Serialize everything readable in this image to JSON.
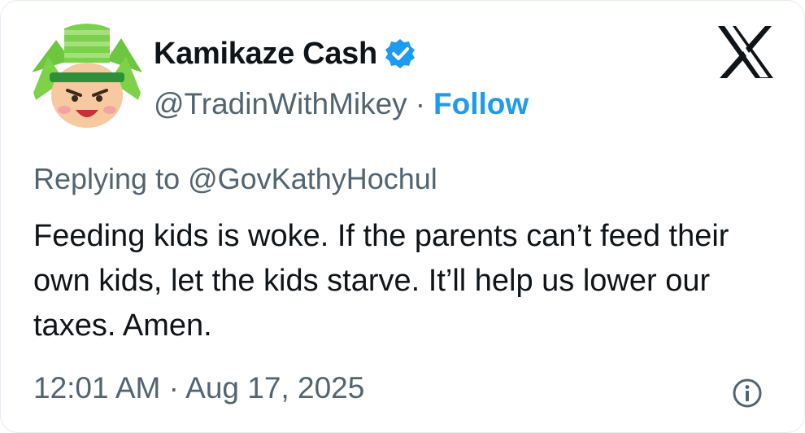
{
  "user": {
    "display_name": "Kamikaze Cash",
    "handle": "@TradinWithMikey",
    "separator": "·",
    "follow_label": "Follow",
    "verified_icon": "verified-badge-icon",
    "avatar_icon": "cartoon-avatar"
  },
  "platform": {
    "logo_icon": "x-logo-icon"
  },
  "tweet": {
    "replying_to": "Replying to @GovKathyHochul",
    "text": "Feeding kids is woke. If the parents can’t feed their own kids, let the kids starve. It’ll help us lower our taxes. Amen.",
    "timestamp": "12:01 AM · Aug 17, 2025",
    "info_icon": "info-icon"
  },
  "colors": {
    "accent": "#1d9bf0",
    "muted": "#536471",
    "text": "#0f1419",
    "avatar_green": "#6cc63f"
  }
}
